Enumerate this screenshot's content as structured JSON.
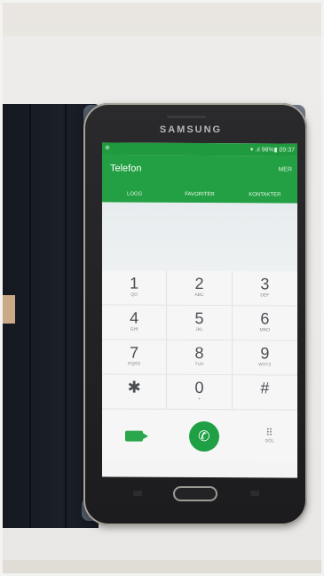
{
  "phone": {
    "brand": "SAMSUNG"
  },
  "status_bar": {
    "settings_icon": "gear-icon",
    "status_text": "▾ .ıl 98%▮ 09:37"
  },
  "app_bar": {
    "title": "Telefon",
    "more_label": "MER",
    "tabs": [
      {
        "label": "LOGG"
      },
      {
        "label": "FAVORITER"
      },
      {
        "label": "KONTAKTER"
      }
    ]
  },
  "keypad": [
    {
      "digit": "1",
      "letters": "QO"
    },
    {
      "digit": "2",
      "letters": "ABC"
    },
    {
      "digit": "3",
      "letters": "DEF"
    },
    {
      "digit": "4",
      "letters": "GHI"
    },
    {
      "digit": "5",
      "letters": "JKL"
    },
    {
      "digit": "6",
      "letters": "MNO"
    },
    {
      "digit": "7",
      "letters": "PQRS"
    },
    {
      "digit": "8",
      "letters": "TUV"
    },
    {
      "digit": "9",
      "letters": "WXYZ"
    },
    {
      "digit": "✱",
      "letters": ""
    },
    {
      "digit": "0",
      "letters": "+"
    },
    {
      "digit": "#",
      "letters": ""
    }
  ],
  "actions": {
    "video_icon": "video-call-icon",
    "call_icon": "phone-icon",
    "call_glyph": "✆",
    "dial_icon": "dialpad-icon",
    "dial_label": "DÖL"
  },
  "colors": {
    "accent_green": "#22a043",
    "status_green": "#1f9a3e",
    "call_green": "#1fa044"
  }
}
